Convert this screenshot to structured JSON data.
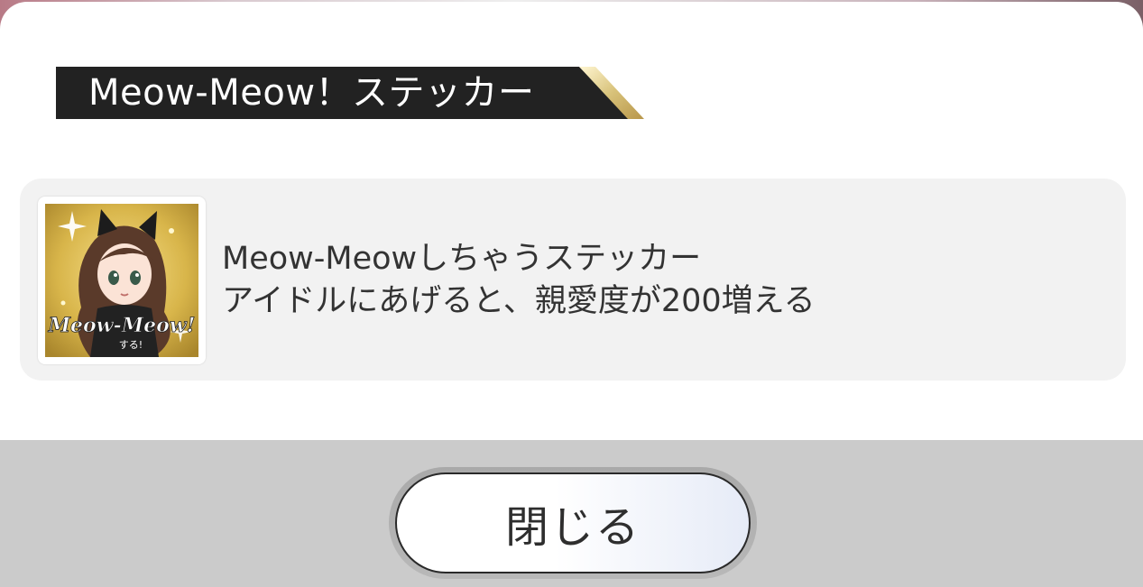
{
  "dialog": {
    "title": "Meow-Meow！ステッカー",
    "item": {
      "thumbnail_icon": "sticker-card-image",
      "thumbnail_text": "Meow-Meow!",
      "thumbnail_subtext": "する!",
      "description_line1": "Meow-Meowしちゃうステッカー",
      "description_line2": "アイドルにあげると、親愛度が200増える"
    }
  },
  "footer": {
    "close_label": "閉じる"
  },
  "colors": {
    "banner_bg": "#222222",
    "banner_accent": "#d8c27a",
    "card_bg": "#f2f2f2",
    "footer_bg": "#cbcbcb"
  }
}
